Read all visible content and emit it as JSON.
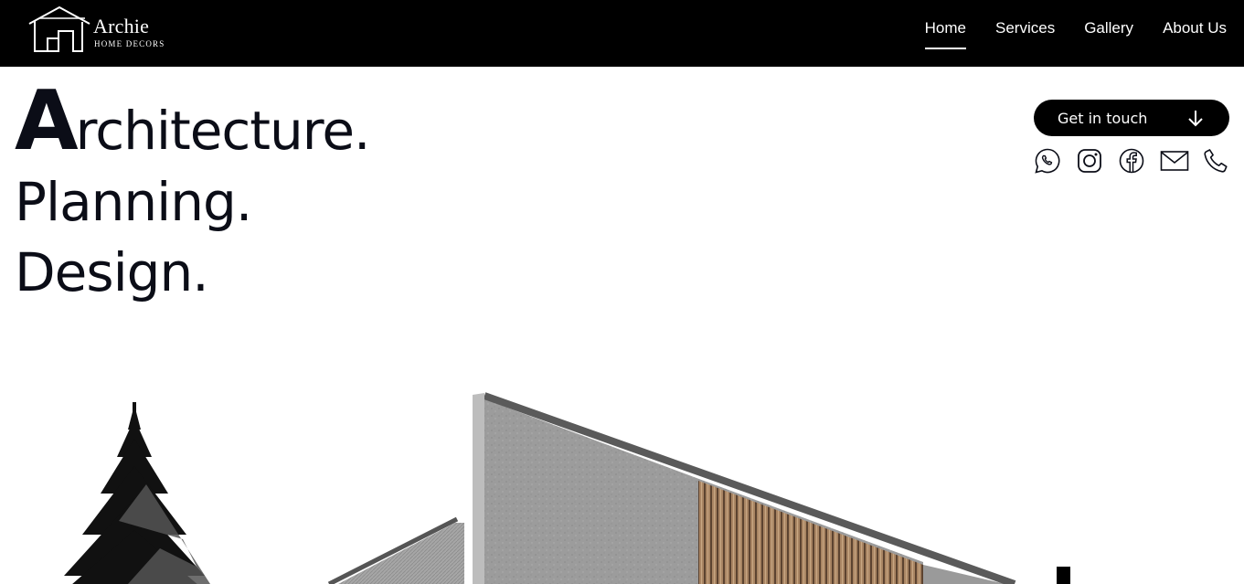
{
  "brand": {
    "name": "Archie",
    "tagline": "HOME DECORS"
  },
  "nav": {
    "items": [
      {
        "label": "Home",
        "active": true
      },
      {
        "label": "Services",
        "active": false
      },
      {
        "label": "Gallery",
        "active": false
      },
      {
        "label": "About Us",
        "active": false
      }
    ]
  },
  "hero": {
    "line1_initial": "A",
    "line1_rest": "rchitecture.",
    "line2": "Planning.",
    "line3": "Design."
  },
  "cta": {
    "label": "Get in touch",
    "icon": "arrow-down-icon"
  },
  "socials": [
    {
      "name": "whatsapp-icon"
    },
    {
      "name": "instagram-icon"
    },
    {
      "name": "facebook-icon"
    },
    {
      "name": "mail-icon"
    },
    {
      "name": "phone-icon"
    }
  ],
  "colors": {
    "header_bg": "#000000",
    "text_dark": "#0b0d17",
    "cta_bg": "#000000",
    "accent_wood": "#8a6a4c",
    "concrete": "#9a9a9a"
  }
}
